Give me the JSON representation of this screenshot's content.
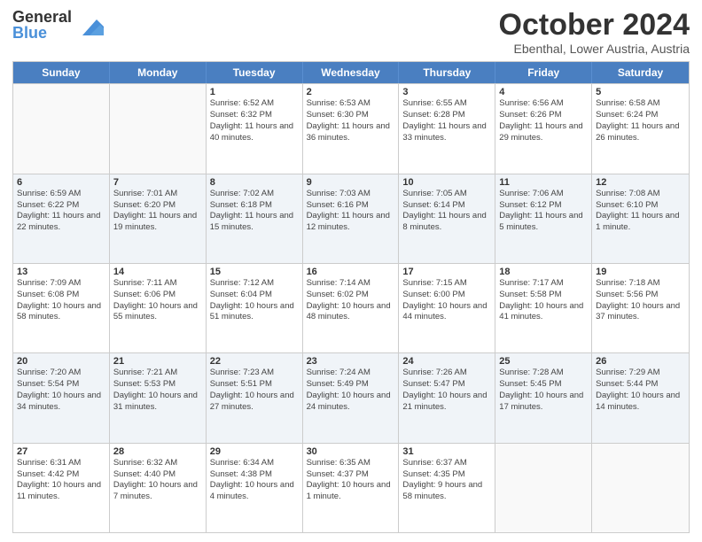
{
  "logo": {
    "general": "General",
    "blue": "Blue"
  },
  "title": "October 2024",
  "location": "Ebenthal, Lower Austria, Austria",
  "days_of_week": [
    "Sunday",
    "Monday",
    "Tuesday",
    "Wednesday",
    "Thursday",
    "Friday",
    "Saturday"
  ],
  "weeks": [
    [
      {
        "day": "",
        "sunrise": "",
        "sunset": "",
        "daylight": "",
        "empty": true
      },
      {
        "day": "",
        "sunrise": "",
        "sunset": "",
        "daylight": "",
        "empty": true
      },
      {
        "day": "1",
        "sunrise": "Sunrise: 6:52 AM",
        "sunset": "Sunset: 6:32 PM",
        "daylight": "Daylight: 11 hours and 40 minutes.",
        "empty": false
      },
      {
        "day": "2",
        "sunrise": "Sunrise: 6:53 AM",
        "sunset": "Sunset: 6:30 PM",
        "daylight": "Daylight: 11 hours and 36 minutes.",
        "empty": false
      },
      {
        "day": "3",
        "sunrise": "Sunrise: 6:55 AM",
        "sunset": "Sunset: 6:28 PM",
        "daylight": "Daylight: 11 hours and 33 minutes.",
        "empty": false
      },
      {
        "day": "4",
        "sunrise": "Sunrise: 6:56 AM",
        "sunset": "Sunset: 6:26 PM",
        "daylight": "Daylight: 11 hours and 29 minutes.",
        "empty": false
      },
      {
        "day": "5",
        "sunrise": "Sunrise: 6:58 AM",
        "sunset": "Sunset: 6:24 PM",
        "daylight": "Daylight: 11 hours and 26 minutes.",
        "empty": false
      }
    ],
    [
      {
        "day": "6",
        "sunrise": "Sunrise: 6:59 AM",
        "sunset": "Sunset: 6:22 PM",
        "daylight": "Daylight: 11 hours and 22 minutes.",
        "empty": false
      },
      {
        "day": "7",
        "sunrise": "Sunrise: 7:01 AM",
        "sunset": "Sunset: 6:20 PM",
        "daylight": "Daylight: 11 hours and 19 minutes.",
        "empty": false
      },
      {
        "day": "8",
        "sunrise": "Sunrise: 7:02 AM",
        "sunset": "Sunset: 6:18 PM",
        "daylight": "Daylight: 11 hours and 15 minutes.",
        "empty": false
      },
      {
        "day": "9",
        "sunrise": "Sunrise: 7:03 AM",
        "sunset": "Sunset: 6:16 PM",
        "daylight": "Daylight: 11 hours and 12 minutes.",
        "empty": false
      },
      {
        "day": "10",
        "sunrise": "Sunrise: 7:05 AM",
        "sunset": "Sunset: 6:14 PM",
        "daylight": "Daylight: 11 hours and 8 minutes.",
        "empty": false
      },
      {
        "day": "11",
        "sunrise": "Sunrise: 7:06 AM",
        "sunset": "Sunset: 6:12 PM",
        "daylight": "Daylight: 11 hours and 5 minutes.",
        "empty": false
      },
      {
        "day": "12",
        "sunrise": "Sunrise: 7:08 AM",
        "sunset": "Sunset: 6:10 PM",
        "daylight": "Daylight: 11 hours and 1 minute.",
        "empty": false
      }
    ],
    [
      {
        "day": "13",
        "sunrise": "Sunrise: 7:09 AM",
        "sunset": "Sunset: 6:08 PM",
        "daylight": "Daylight: 10 hours and 58 minutes.",
        "empty": false
      },
      {
        "day": "14",
        "sunrise": "Sunrise: 7:11 AM",
        "sunset": "Sunset: 6:06 PM",
        "daylight": "Daylight: 10 hours and 55 minutes.",
        "empty": false
      },
      {
        "day": "15",
        "sunrise": "Sunrise: 7:12 AM",
        "sunset": "Sunset: 6:04 PM",
        "daylight": "Daylight: 10 hours and 51 minutes.",
        "empty": false
      },
      {
        "day": "16",
        "sunrise": "Sunrise: 7:14 AM",
        "sunset": "Sunset: 6:02 PM",
        "daylight": "Daylight: 10 hours and 48 minutes.",
        "empty": false
      },
      {
        "day": "17",
        "sunrise": "Sunrise: 7:15 AM",
        "sunset": "Sunset: 6:00 PM",
        "daylight": "Daylight: 10 hours and 44 minutes.",
        "empty": false
      },
      {
        "day": "18",
        "sunrise": "Sunrise: 7:17 AM",
        "sunset": "Sunset: 5:58 PM",
        "daylight": "Daylight: 10 hours and 41 minutes.",
        "empty": false
      },
      {
        "day": "19",
        "sunrise": "Sunrise: 7:18 AM",
        "sunset": "Sunset: 5:56 PM",
        "daylight": "Daylight: 10 hours and 37 minutes.",
        "empty": false
      }
    ],
    [
      {
        "day": "20",
        "sunrise": "Sunrise: 7:20 AM",
        "sunset": "Sunset: 5:54 PM",
        "daylight": "Daylight: 10 hours and 34 minutes.",
        "empty": false
      },
      {
        "day": "21",
        "sunrise": "Sunrise: 7:21 AM",
        "sunset": "Sunset: 5:53 PM",
        "daylight": "Daylight: 10 hours and 31 minutes.",
        "empty": false
      },
      {
        "day": "22",
        "sunrise": "Sunrise: 7:23 AM",
        "sunset": "Sunset: 5:51 PM",
        "daylight": "Daylight: 10 hours and 27 minutes.",
        "empty": false
      },
      {
        "day": "23",
        "sunrise": "Sunrise: 7:24 AM",
        "sunset": "Sunset: 5:49 PM",
        "daylight": "Daylight: 10 hours and 24 minutes.",
        "empty": false
      },
      {
        "day": "24",
        "sunrise": "Sunrise: 7:26 AM",
        "sunset": "Sunset: 5:47 PM",
        "daylight": "Daylight: 10 hours and 21 minutes.",
        "empty": false
      },
      {
        "day": "25",
        "sunrise": "Sunrise: 7:28 AM",
        "sunset": "Sunset: 5:45 PM",
        "daylight": "Daylight: 10 hours and 17 minutes.",
        "empty": false
      },
      {
        "day": "26",
        "sunrise": "Sunrise: 7:29 AM",
        "sunset": "Sunset: 5:44 PM",
        "daylight": "Daylight: 10 hours and 14 minutes.",
        "empty": false
      }
    ],
    [
      {
        "day": "27",
        "sunrise": "Sunrise: 6:31 AM",
        "sunset": "Sunset: 4:42 PM",
        "daylight": "Daylight: 10 hours and 11 minutes.",
        "empty": false
      },
      {
        "day": "28",
        "sunrise": "Sunrise: 6:32 AM",
        "sunset": "Sunset: 4:40 PM",
        "daylight": "Daylight: 10 hours and 7 minutes.",
        "empty": false
      },
      {
        "day": "29",
        "sunrise": "Sunrise: 6:34 AM",
        "sunset": "Sunset: 4:38 PM",
        "daylight": "Daylight: 10 hours and 4 minutes.",
        "empty": false
      },
      {
        "day": "30",
        "sunrise": "Sunrise: 6:35 AM",
        "sunset": "Sunset: 4:37 PM",
        "daylight": "Daylight: 10 hours and 1 minute.",
        "empty": false
      },
      {
        "day": "31",
        "sunrise": "Sunrise: 6:37 AM",
        "sunset": "Sunset: 4:35 PM",
        "daylight": "Daylight: 9 hours and 58 minutes.",
        "empty": false
      },
      {
        "day": "",
        "sunrise": "",
        "sunset": "",
        "daylight": "",
        "empty": true
      },
      {
        "day": "",
        "sunrise": "",
        "sunset": "",
        "daylight": "",
        "empty": true
      }
    ]
  ]
}
